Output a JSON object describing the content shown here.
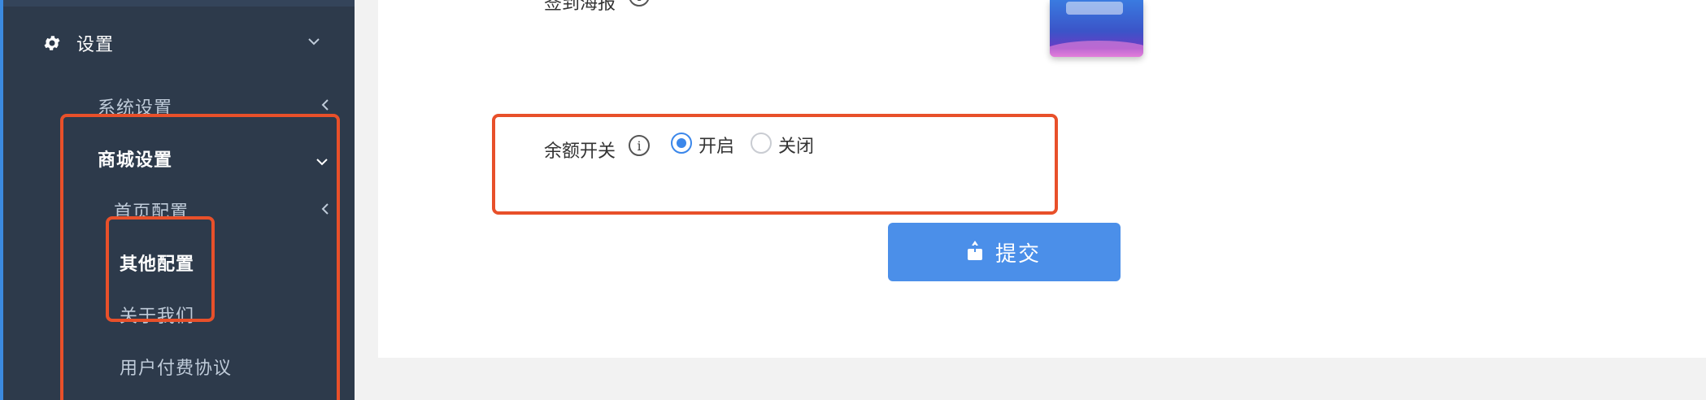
{
  "sidebar": {
    "settings_label": "设置",
    "system_settings_label": "系统设置",
    "mall_settings_label": "商城设置",
    "homepage_config_label": "首页配置",
    "other_config_label": "其他配置",
    "about_us_label": "关于我们",
    "user_agreement_label": "用户付费协议"
  },
  "form": {
    "poster_label": "签到海报",
    "balance_switch_label": "余额开关",
    "info_glyph": "i",
    "option_on": "开启",
    "option_off": "关闭",
    "selected": "开启"
  },
  "actions": {
    "submit_label": "提交"
  },
  "icons": {
    "settings": "gear-icon",
    "submit": "upload-icon"
  },
  "colors": {
    "sidebar_bg": "#2d3a4b",
    "highlight": "#e8502a",
    "primary": "#4b8fe9"
  }
}
